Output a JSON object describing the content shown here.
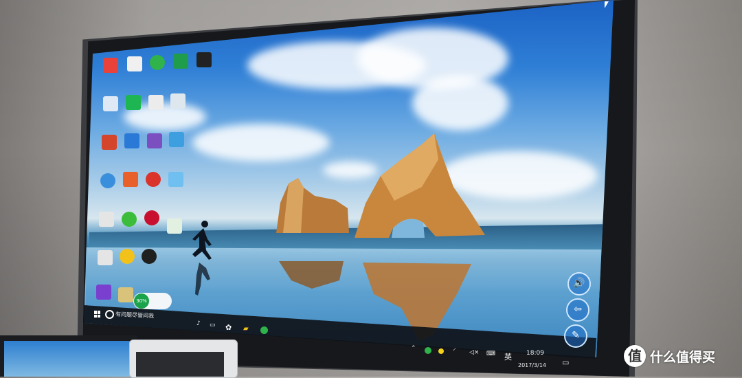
{
  "photo": {
    "subject": "monitor-displaying-windows-10-desktop"
  },
  "desktop": {
    "icons": [
      {
        "name": "app-icon-1",
        "color": "#e8423a"
      },
      {
        "name": "document-icon",
        "color": "#f0f0f0"
      },
      {
        "name": "browser-icon",
        "color": "#2fb34a"
      },
      {
        "name": "shield-icon",
        "color": "#1f9d4a"
      },
      {
        "name": "video-thumbnail-icon",
        "color": "#222222"
      },
      {
        "name": "word-file-icon",
        "color": "#dfe8f5"
      },
      {
        "name": "wps-icon",
        "color": "#1eb553"
      },
      {
        "name": "file-icon",
        "color": "#ececec"
      },
      {
        "name": "recycle-bin-icon",
        "color": "#dfe7ee"
      },
      {
        "name": "books-icon",
        "color": "#d4452b"
      },
      {
        "name": "wps-writer-icon",
        "color": "#2b79d6"
      },
      {
        "name": "app-icon-2",
        "color": "#7b4fc0"
      },
      {
        "name": "folder-icon",
        "color": "#3d9ee0"
      },
      {
        "name": "ie-icon",
        "color": "#3a8fdc"
      },
      {
        "name": "wps-presentation-icon",
        "color": "#e8602a"
      },
      {
        "name": "music-icon",
        "color": "#d9332c"
      },
      {
        "name": "monitor-icon",
        "color": "#6fbff0"
      },
      {
        "name": "doc-icon",
        "color": "#e5e5e5"
      },
      {
        "name": "wechat-icon",
        "color": "#3bbd3b"
      },
      {
        "name": "bank-icon",
        "color": "#c8102e"
      },
      {
        "name": "image-file-icon",
        "color": "#e2f0e2"
      },
      {
        "name": "file-icon-2",
        "color": "#e5e5e5"
      },
      {
        "name": "plus-app-icon",
        "color": "#f2c21b"
      },
      {
        "name": "qq-icon",
        "color": "#1f1f1f"
      },
      {
        "name": "purple-app-icon",
        "color": "#7a3fcf"
      },
      {
        "name": "person-file-icon",
        "color": "#d9c37a"
      }
    ],
    "widget_percent": "30%"
  },
  "taskbar": {
    "search_placeholder": "有问题尽管问我",
    "ime_label": "英",
    "time": "18:09",
    "date": "2017/3/14"
  },
  "side_buttons": [
    {
      "name": "volume-button-icon",
      "glyph": "🔊"
    },
    {
      "name": "back-arrow-icon",
      "glyph": "⇦"
    },
    {
      "name": "annotate-pen-icon",
      "glyph": "✎"
    }
  ],
  "watermark": {
    "logo": "值",
    "text": "什么值得买"
  },
  "colors": {
    "sky_top": "#1b62c4",
    "rock": "#c98a3a",
    "taskbar": "#0f1218",
    "accent_green": "#1aa34a"
  }
}
